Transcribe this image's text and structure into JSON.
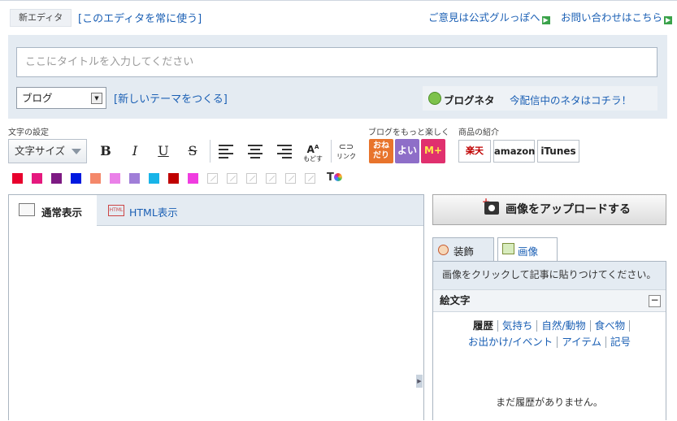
{
  "topbar": {
    "editor_tag": "新エディタ",
    "always_use_link": "[このエディタを常に使う]",
    "feedback_link": "ご意見は公式グルっぽへ",
    "contact_link": "お問い合わせはこちら"
  },
  "title": {
    "placeholder": "ここにタイトルを入力してください",
    "value": ""
  },
  "theme": {
    "selected": "ブログ",
    "new_theme_link": "[新しいテーマをつくる]"
  },
  "neta": {
    "label": "ブログネタ",
    "link": "今配信中のネタはコチラ！"
  },
  "sections": {
    "text_settings": "文字の設定",
    "enjoy_blog": "ブログをもっと楽しく",
    "products": "商品の紹介"
  },
  "toolbar": {
    "font_size_label": "文字サイズ",
    "bold": "B",
    "italic": "I",
    "underline": "U",
    "strike": "S",
    "reset_label": "もどす",
    "link_label": "リンク"
  },
  "blog_buttons": [
    {
      "label": "おね だり",
      "color": "#e8742c"
    },
    {
      "label": "よい",
      "color": "#8e6ec8"
    },
    {
      "label": "M+",
      "color": "#e0306e"
    }
  ],
  "shop_buttons": [
    {
      "label": "楽天"
    },
    {
      "label": "amazon"
    },
    {
      "label": "iTunes"
    }
  ],
  "palette": [
    "#e8002d",
    "#e5197e",
    "#7d1a83",
    "#0019e0",
    "#f4886a",
    "#ea80e8",
    "#a07ed8",
    "#18b4e8",
    "#c00000",
    "#f03ce0"
  ],
  "editor": {
    "tab_normal": "通常表示",
    "tab_html": "HTML表示",
    "html_icon": "HTML"
  },
  "sidebar": {
    "upload_button": "画像をアップロードする",
    "tab_decoration": "装飾",
    "tab_image": "画像",
    "hint": "画像をクリックして記事に貼りつけてください。",
    "emoji_header": "絵文字",
    "collapse": "−",
    "categories": [
      {
        "label": "履歴",
        "active": true
      },
      {
        "label": "気持ち"
      },
      {
        "label": "自然/動物"
      },
      {
        "label": "食べ物"
      },
      {
        "label": "お出かけ/イベント"
      },
      {
        "label": "アイテム"
      },
      {
        "label": "記号"
      }
    ],
    "empty_message": "まだ履歴がありません。"
  }
}
